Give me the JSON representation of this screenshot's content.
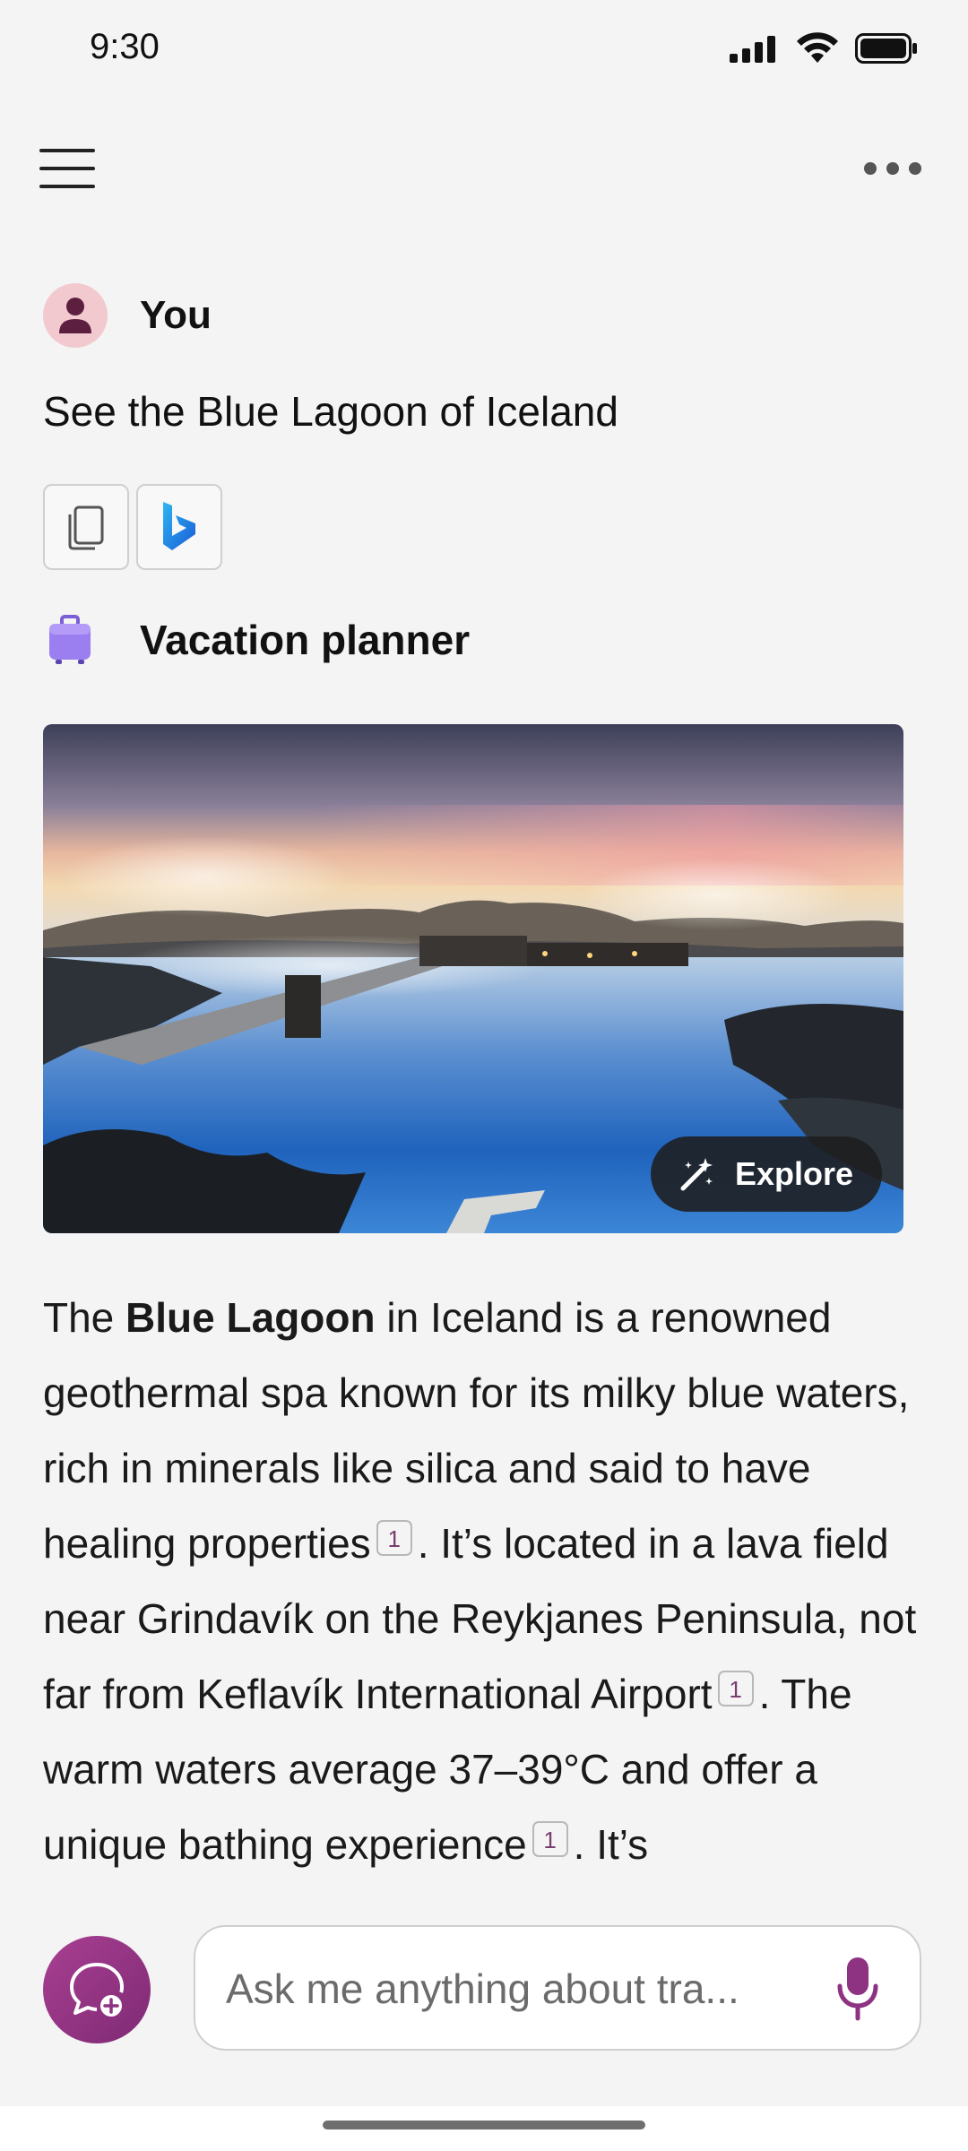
{
  "status_bar": {
    "time": "9:30"
  },
  "user": {
    "name": "You",
    "message": "See the Blue Lagoon of Iceland"
  },
  "assistant": {
    "name": "Vacation planner",
    "explore_label": "Explore",
    "answer": {
      "p1": "The ",
      "bold": "Blue Lagoon",
      "p2": " in Iceland is a renowned geothermal spa known for its milky blue waters, rich in minerals like silica and said to have healing properties",
      "c1": "1",
      "p3": ". It’s located in a lava field near Grindavík on the Reykjanes Peninsula, not far from Keflavík International Airport",
      "c2": "1",
      "p4": ". The warm waters average 37–39°C and offer a unique bathing experience",
      "c3": "1",
      "p5": ". It’s"
    }
  },
  "composer": {
    "placeholder": "Ask me anything about tra..."
  },
  "colors": {
    "accent": "#9c3a8c",
    "background": "#f4f4f4"
  },
  "icons": {
    "menu": "hamburger-icon",
    "more": "more-icon",
    "copy": "copy-icon",
    "bing": "bing-icon",
    "suitcase": "suitcase-icon",
    "explore": "magic-wand-icon",
    "new_chat": "new-chat-icon",
    "mic": "microphone-icon"
  }
}
